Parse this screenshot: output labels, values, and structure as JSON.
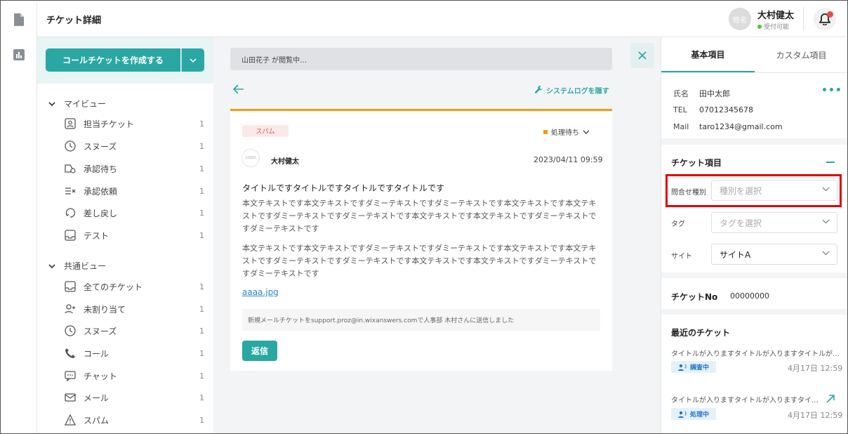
{
  "header": {
    "title": "チケット詳細",
    "avatar_text": "姓名",
    "user_name": "大村健太",
    "user_status": "受付可能"
  },
  "sidebar": {
    "create_button": "コールチケットを作成する",
    "myview": {
      "label": "マイビュー",
      "items": [
        {
          "label": "担当チケット",
          "count": "1",
          "icon": "assigned-ticket-icon"
        },
        {
          "label": "スヌーズ",
          "count": "1",
          "icon": "clock-icon"
        },
        {
          "label": "承認待ち",
          "count": "1",
          "icon": "approval-pending-icon"
        },
        {
          "label": "承認依頼",
          "count": "1",
          "icon": "approval-request-icon"
        },
        {
          "label": "差し戻し",
          "count": "1",
          "icon": "sendback-icon"
        },
        {
          "label": "テスト",
          "count": "1",
          "icon": "inbox-icon"
        }
      ]
    },
    "common": {
      "label": "共通ビュー",
      "items": [
        {
          "label": "全てのチケット",
          "count": "1",
          "icon": "inbox-icon"
        },
        {
          "label": "未割り当て",
          "count": "1",
          "icon": "add-user-icon"
        },
        {
          "label": "スヌーズ",
          "count": "1",
          "icon": "clock-icon"
        },
        {
          "label": "コール",
          "count": "1",
          "icon": "phone-icon"
        },
        {
          "label": "チャット",
          "count": "1",
          "icon": "chat-icon"
        },
        {
          "label": "メール",
          "count": "1",
          "icon": "mail-icon"
        },
        {
          "label": "スパム",
          "count": "1",
          "icon": "warning-icon"
        }
      ]
    }
  },
  "ticket": {
    "viewing": "山田花子 が閲覧中…",
    "syslog_label": "システムログを隠す",
    "tag": "スパム",
    "status": "処理待ち",
    "logo_text": "LOGO",
    "sender": "大村健太",
    "datetime": "2023/04/11 09:59",
    "subject": "タイトルですタイトルですタイトルですタイトルです",
    "body1": "本文テキストです本文テキストですダミーテキストですダミーテキストです本文テキストです本文テキストですダミーテキストですダミーテキストです本文テキストです本文テキストですダミーテキストですダミーテキストです",
    "body2": "本文テキストです本文テキストですダミーテキストですダミーテキストです本文テキストです本文テキストですダミーテキストですダミーテキストです本文テキストです本文テキストですダミーテキストですダミーテキストです",
    "attachment": "aaaa.jpg",
    "log": "新規メールチケットをsupport.proz@in.wixanswers.comで人事部 木村さんに送信しました",
    "reply_label": "返信"
  },
  "right": {
    "tabs": [
      "基本項目",
      "カスタム項目"
    ],
    "contact": {
      "name_label": "氏名",
      "name": "田中太郎",
      "tel_label": "TEL",
      "tel": "07012345678",
      "mail_label": "Mail",
      "mail": "taro1234@gmail.com"
    },
    "ticket_items_title": "チケット項目",
    "fields": {
      "inquiry_label": "問合せ種別",
      "inquiry_placeholder": "種別を選択",
      "tag_label": "タグ",
      "tag_placeholder": "タグを選択",
      "site_label": "サイト",
      "site_value": "サイトA"
    },
    "ticket_no_label": "チケットNo",
    "ticket_no": "00000000",
    "recent_title": "最近のチケット",
    "recent": [
      {
        "title": "タイトルが入りますタイトルが入りますタイトルが…",
        "status": "調査中",
        "date": "4月17日 12:59"
      },
      {
        "title": "タイトルが入りますタイトルが入りますタイ…",
        "status": "処理中",
        "date": "4月17日 12:59"
      }
    ]
  },
  "colors": {
    "accent": "#2aa7a2",
    "status_orange": "#f39c12",
    "highlight_red": "#e00000"
  }
}
